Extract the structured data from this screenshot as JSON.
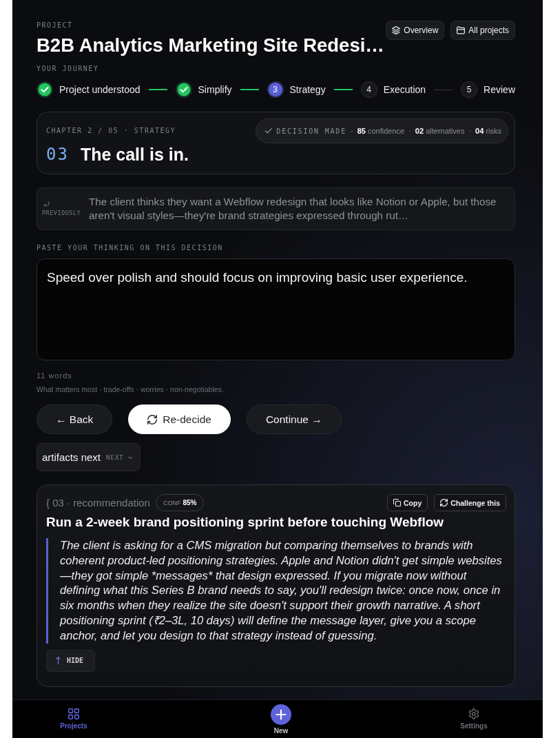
{
  "header": {
    "eyebrow": "PROJECT",
    "title": "B2B Analytics Marketing Site Redesi…",
    "actions": [
      {
        "label": "Overview"
      },
      {
        "label": "All projects"
      }
    ]
  },
  "journey": {
    "label": "YOUR JOURNEY",
    "steps": [
      {
        "label": "Project understood",
        "completed": true,
        "selected": false
      },
      {
        "label": "Simplify",
        "completed": true,
        "selected": false
      },
      {
        "number": "3",
        "label": "Strategy",
        "completed": false,
        "selected": true
      },
      {
        "number": "4",
        "label": "Execution",
        "completed": false,
        "selected": false
      },
      {
        "number": "5",
        "label": "Review",
        "completed": false,
        "selected": false
      }
    ]
  },
  "chapter": {
    "eyebrow": "CHAPTER 2 / 05 · STRATEGY",
    "number": "03",
    "heading": "The call is in.",
    "decision": {
      "label": "DECISION MADE",
      "separator": "·",
      "stats": [
        "**85** confidence",
        "**02** alternatives",
        "**04** risks"
      ]
    }
  },
  "previously": {
    "label": "PREVIOUSLY",
    "text": "The client thinks they want a Webflow redesign that looks like Notion or Apple, but those aren't visual styles—they're brand strategies expressed through rut…"
  },
  "thinking": {
    "label": "PASTE YOUR THINKING ON THIS DECISION",
    "value": "Speed over polish and should focus on improving basic user experience.",
    "word_count": "11 words",
    "hint": "What matters most · trade-offs · worries · non-negotiables."
  },
  "actions": [
    {
      "label": "← Back",
      "kind": "secondary"
    },
    {
      "label": "Re-decide",
      "kind": "primary"
    },
    {
      "label": "Continue →",
      "kind": "secondary"
    }
  ],
  "next_chip": {
    "label": "artifacts next",
    "tag": "NEXT ↪"
  },
  "recommendation": {
    "eyebrow": "{ 03 · recommendation",
    "confidence_label": "CONF",
    "confidence_value": "85%",
    "buttons": [
      {
        "label": "Copy"
      },
      {
        "label": "Challenge this"
      }
    ],
    "title": "Run a 2-week brand positioning sprint before touching Webflow",
    "body": "The client is asking for a CMS migration but comparing themselves to brands with coherent product-led positioning strategies. Apple and Notion didn't get simple websites—they got simple *messages* that design expressed. If you migrate now without defining what this Series B brand needs to say, you'll redesign twice: once now, once in six months when they realize the site doesn't support their growth narrative. A short positioning sprint (₹2–3L, 10 days) will define the message layer, give you a scope anchor, and let you design to that strategy instead of guessing.",
    "hide_label": "HIDE"
  },
  "nav": {
    "items": [
      {
        "label": "Projects",
        "kind": "tab",
        "selected": true
      },
      {
        "label": "New",
        "kind": "create",
        "selected": false
      },
      {
        "label": "Settings",
        "kind": "tab",
        "selected": false
      }
    ]
  }
}
